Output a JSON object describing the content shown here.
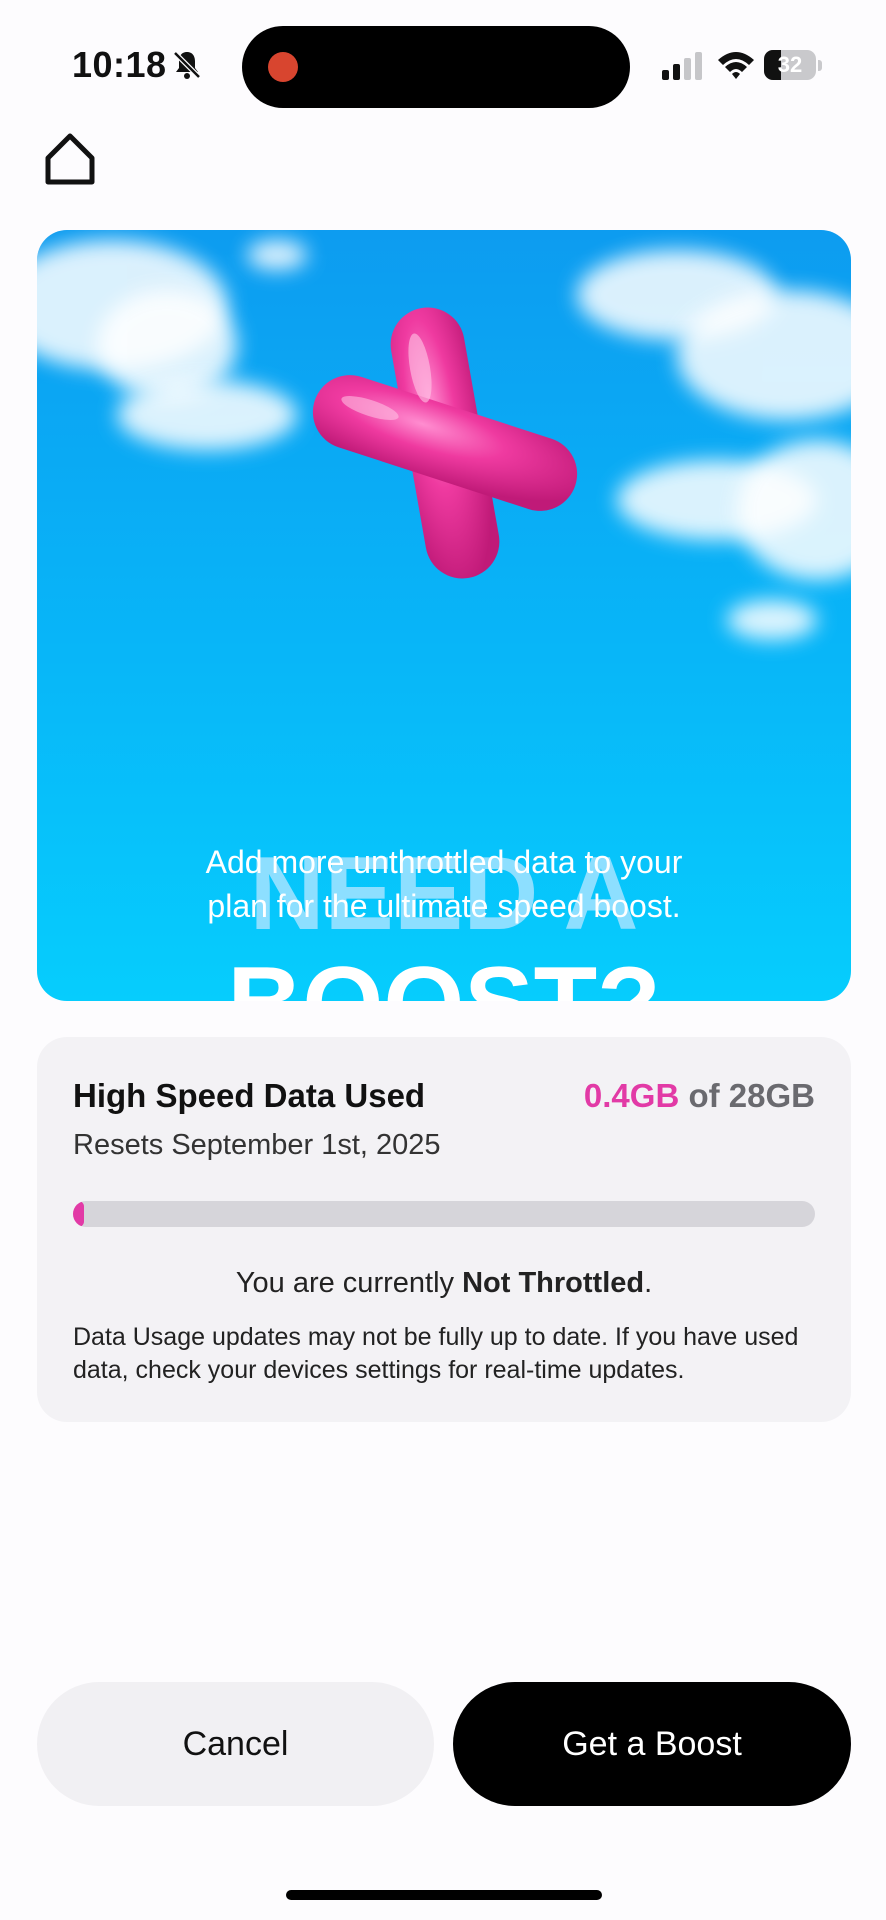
{
  "status_bar": {
    "time": "10:18",
    "battery_level": 32,
    "battery_text": "32",
    "icons": [
      "bell-slash-icon",
      "cellular-signal-icon",
      "wifi-icon",
      "battery-icon"
    ],
    "recording_color": "#d8452f"
  },
  "nav": {
    "home_icon": "home-icon"
  },
  "hero": {
    "headline_line1": "NEED A",
    "headline_line2": "BOOST?",
    "subtitle_line1": "Add more unthrottled data to your",
    "subtitle_line2": "plan for the ultimate speed boost.",
    "accent_color": "#e23aa6"
  },
  "usage_card": {
    "title": "High Speed Data Used",
    "used": "0.4GB",
    "of_label": "of",
    "total": "28GB",
    "reset_text": "Resets September 1st, 2025",
    "progress_fraction": 0.0143,
    "throttle_prefix": "You are currently",
    "throttle_status": "Not Throttled",
    "throttle_suffix": ".",
    "note": "Data Usage updates may not be fully up to date. If you have used data, check your devices settings for real-time updates."
  },
  "actions": {
    "cancel_label": "Cancel",
    "boost_label": "Get a Boost"
  }
}
